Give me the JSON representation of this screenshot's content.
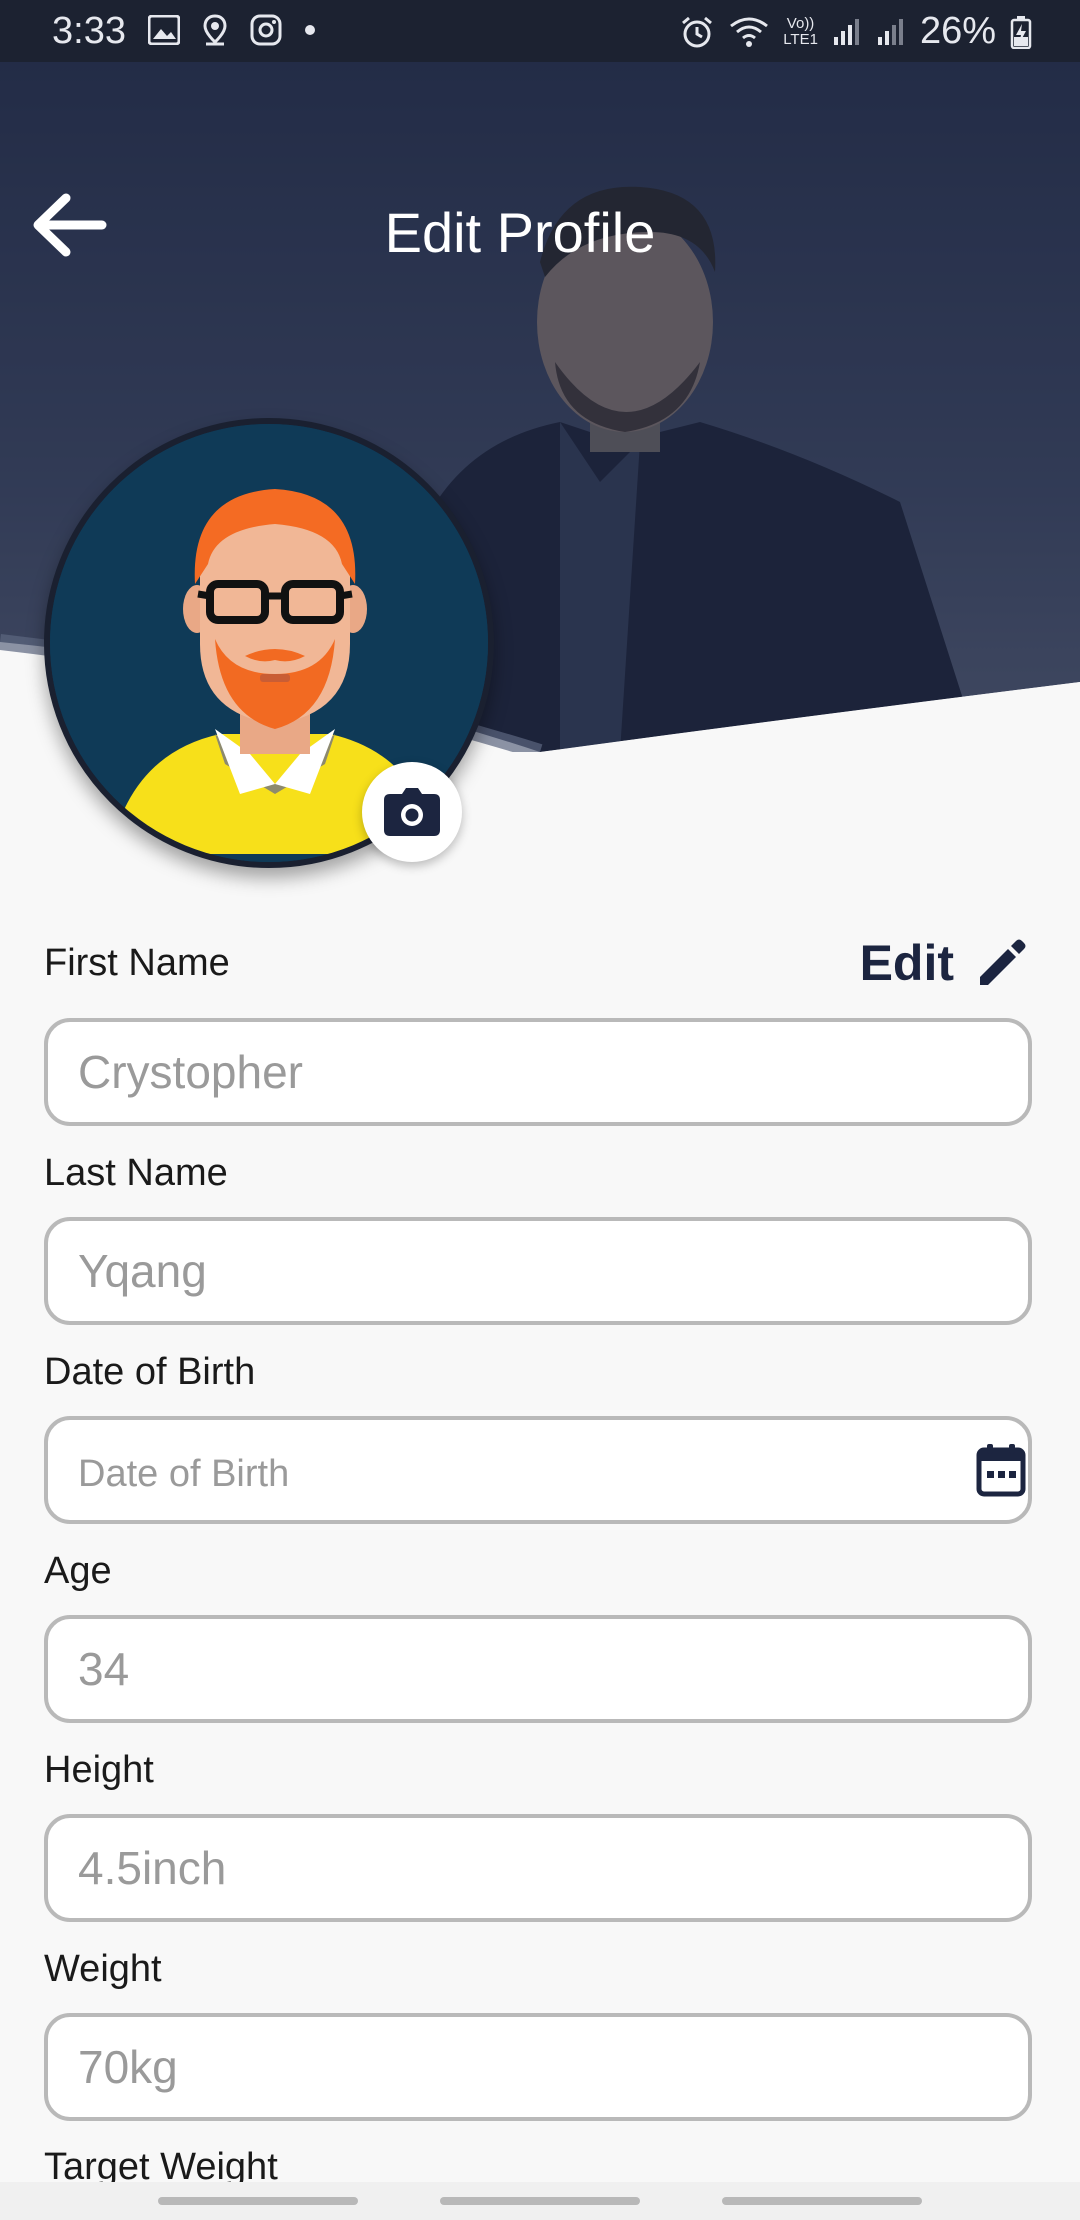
{
  "status_bar": {
    "time": "3:33",
    "battery": "26%",
    "network": "LTE1",
    "voice": "Vo))"
  },
  "header": {
    "title": "Edit Profile"
  },
  "form": {
    "edit_label": "Edit",
    "fields": [
      {
        "label": "First Name",
        "placeholder": "Crystopher"
      },
      {
        "label": "Last Name",
        "placeholder": "Yqang"
      },
      {
        "label": "Date of Birth",
        "placeholder": "Date of Birth"
      },
      {
        "label": "Age",
        "placeholder": "34"
      },
      {
        "label": "Height",
        "placeholder": "4.5inch"
      },
      {
        "label": "Weight",
        "placeholder": "70kg"
      },
      {
        "label": "Target Weight"
      }
    ]
  },
  "colors": {
    "accent": "#1c2540",
    "header_overlay": "#1e2640",
    "input_border": "#b9b9b9"
  },
  "icons": {
    "back": "arrow-left-icon",
    "camera": "camera-icon",
    "edit": "pencil-icon",
    "calendar": "calendar-icon"
  }
}
